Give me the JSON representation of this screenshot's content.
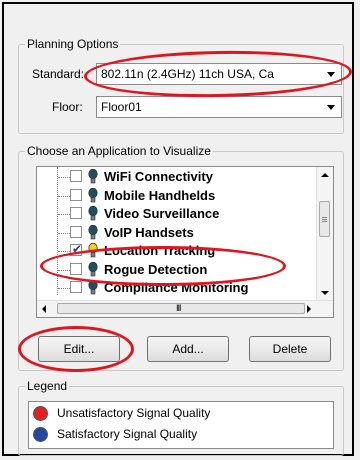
{
  "planning": {
    "title": "Planning Options",
    "standard_label": "Standard:",
    "standard_value": "802.11n (2.4GHz) 11ch USA, Ca",
    "floor_label": "Floor:",
    "floor_value": "Floor01"
  },
  "apps": {
    "title": "Choose an Application to Visualize",
    "items": [
      {
        "label": "WiFi Connectivity",
        "checked": false,
        "bulb_color": "#1f4f5f"
      },
      {
        "label": "Mobile Handhelds",
        "checked": false,
        "bulb_color": "#1f4f5f"
      },
      {
        "label": "Video Surveillance",
        "checked": false,
        "bulb_color": "#1f4f5f"
      },
      {
        "label": "VoIP Handsets",
        "checked": false,
        "bulb_color": "#1f4f5f"
      },
      {
        "label": "Location Tracking",
        "checked": true,
        "bulb_color": "#f2d21b"
      },
      {
        "label": "Rogue Detection",
        "checked": false,
        "bulb_color": "#1f4f5f"
      },
      {
        "label": "Compliance Monitoring",
        "checked": false,
        "bulb_color": "#1f4f5f"
      }
    ],
    "scroll_grip": "III"
  },
  "buttons": {
    "edit": "Edit...",
    "add": "Add...",
    "delete": "Delete"
  },
  "legend": {
    "title": "Legend",
    "items": [
      {
        "label": "Unsatisfactory Signal Quality",
        "color": "#e41e26"
      },
      {
        "label": "Satisfactory Signal Quality",
        "color": "#2447a0"
      }
    ]
  },
  "colors": {
    "annotation": "#e0161e"
  }
}
